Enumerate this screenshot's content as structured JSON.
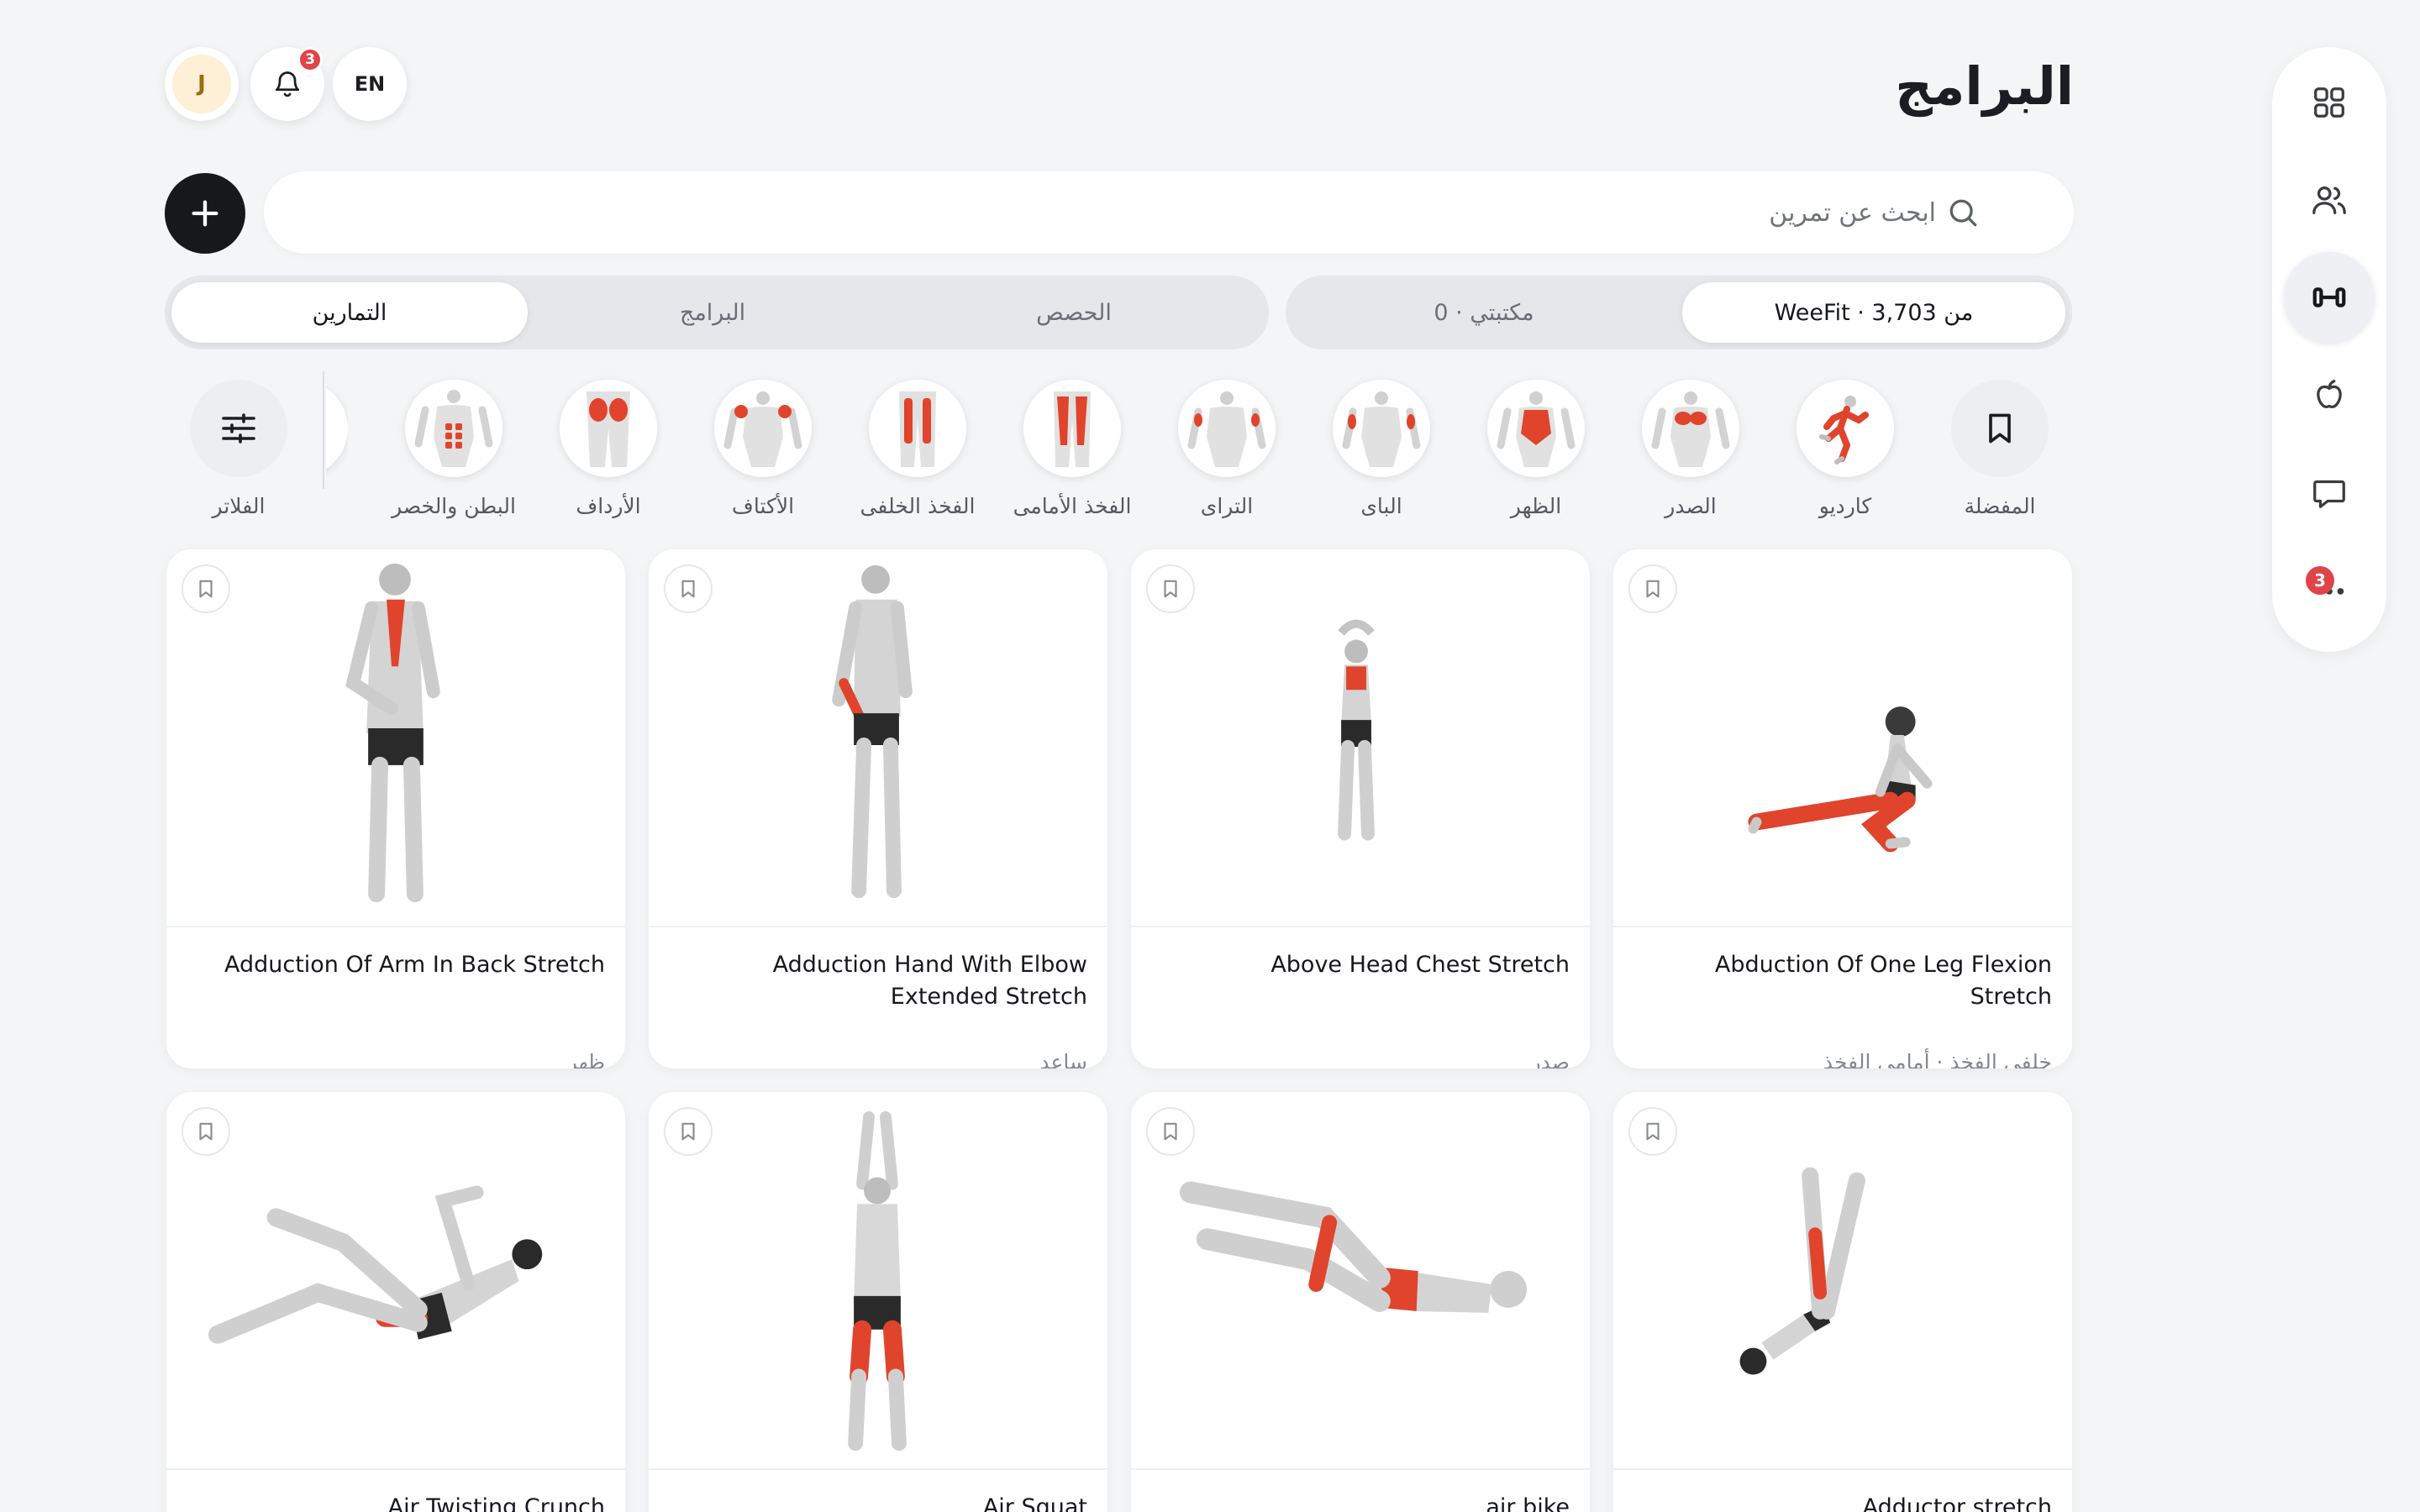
{
  "header": {
    "title": "البرامج",
    "lang_label": "EN",
    "notif_count": "3",
    "avatar_initial": "J"
  },
  "search": {
    "placeholder": "ابحث عن تمرين"
  },
  "source_tabs": [
    {
      "label": "من WeeFit · 3,703",
      "active": true
    },
    {
      "label": "مكتبتي · 0",
      "active": false
    }
  ],
  "type_tabs": [
    {
      "label": "التمارين",
      "active": true
    },
    {
      "label": "البرامج",
      "active": false
    },
    {
      "label": "الحصص",
      "active": false
    }
  ],
  "categories": [
    {
      "label": "المفضلة",
      "icon": "bookmark-icon"
    },
    {
      "label": "كارديو",
      "icon": "cardio-icon"
    },
    {
      "label": "الصدر",
      "icon": "chest-icon"
    },
    {
      "label": "الظهر",
      "icon": "back-icon"
    },
    {
      "label": "البای",
      "icon": "biceps-icon"
    },
    {
      "label": "الترای",
      "icon": "triceps-icon"
    },
    {
      "label": "الفخذ الأمامی",
      "icon": "quads-icon"
    },
    {
      "label": "الفخذ الخلفی",
      "icon": "hamstrings-icon"
    },
    {
      "label": "الأكتاف",
      "icon": "shoulders-icon"
    },
    {
      "label": "الأرداف",
      "icon": "glutes-icon"
    },
    {
      "label": "البطن والخصر",
      "icon": "abs-icon"
    }
  ],
  "filters_label": "الفلاتر",
  "sidebar": {
    "more_badge": "3",
    "items": [
      "dashboard-icon",
      "users-icon",
      "dumbbell-icon",
      "nutrition-icon",
      "chat-icon",
      "more-icon"
    ]
  },
  "exercises": [
    {
      "title": "Abduction Of One Leg Flexion Stretch",
      "tag": "خلفی الفخذ · أمامی الفخذ"
    },
    {
      "title": "Above Head Chest Stretch",
      "tag": "صدر"
    },
    {
      "title": "Adduction Hand With Elbow Extended Stretch",
      "tag": "ساعد"
    },
    {
      "title": "Adduction Of Arm In Back Stretch",
      "tag": "ظهر"
    },
    {
      "title": "Adductor stretch",
      "tag": ""
    },
    {
      "title": "air bike",
      "tag": ""
    },
    {
      "title": "Air Squat",
      "tag": ""
    },
    {
      "title": "Air Twisting Crunch",
      "tag": ""
    }
  ],
  "colors": {
    "accent_dark": "#17181c",
    "muscle_highlight": "#e0442c",
    "badge_red": "#e04448",
    "background": "#f4f5f7"
  }
}
